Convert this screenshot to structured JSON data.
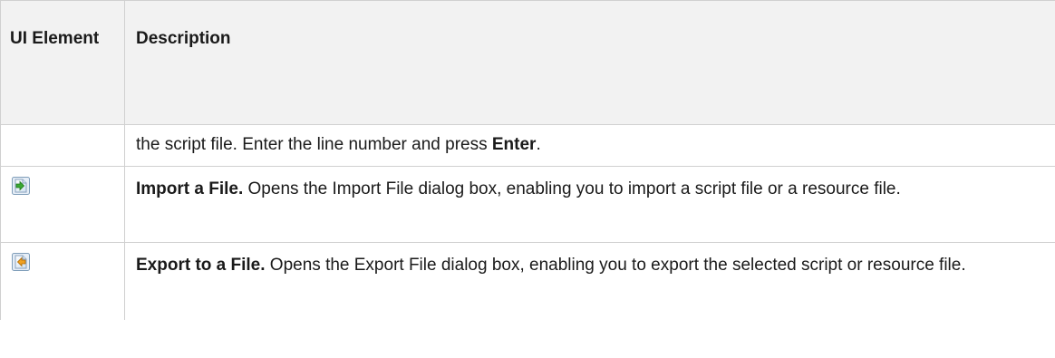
{
  "table": {
    "headers": {
      "ui_element": "UI Element",
      "description": "Description"
    },
    "rows": [
      {
        "icon": null,
        "description_text": "the script file. Enter the line number and press ",
        "description_bold_tail": "Enter",
        "description_end": "."
      },
      {
        "icon": "import-file-icon",
        "title": "Import a File.",
        "description": " Opens the Import File dialog box, enabling you to import a script file or a resource file."
      },
      {
        "icon": "export-file-icon",
        "title": "Export to a File.",
        "description": " Opens the Export File dialog box, enabling you to export the selected script or resource file."
      }
    ]
  },
  "colors": {
    "header_bg": "#f2f2f2",
    "border": "#d0d0d0",
    "icon_arrow": "#3aa832"
  }
}
